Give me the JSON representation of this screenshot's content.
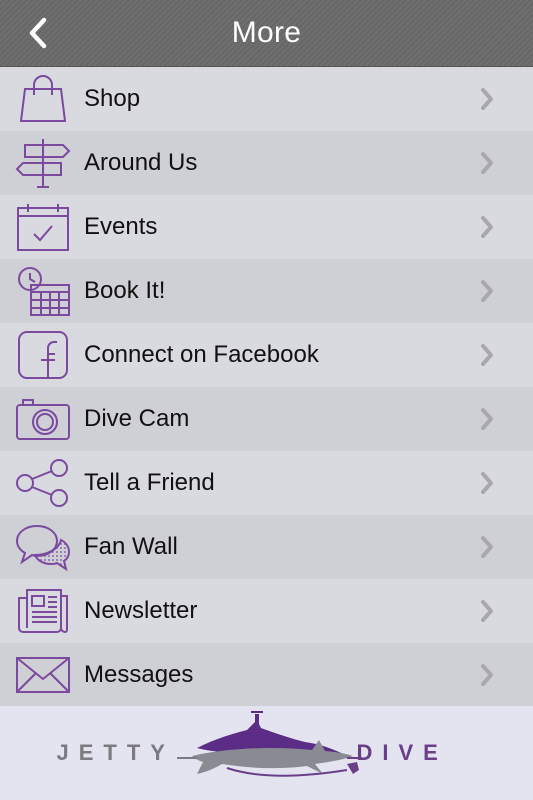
{
  "header": {
    "title": "More",
    "back_icon": "chevron-left-icon"
  },
  "colors": {
    "accent": "#7b4a9e",
    "header_bg": "#6c6c6c",
    "row_bg": "#d9d9e0",
    "row_alt_bg": "#cfcfd6",
    "chevron": "#a9a9ad"
  },
  "menu": {
    "items": [
      {
        "label": "Shop",
        "icon": "shopping-bag-icon"
      },
      {
        "label": "Around Us",
        "icon": "signpost-icon"
      },
      {
        "label": "Events",
        "icon": "calendar-check-icon"
      },
      {
        "label": "Book It!",
        "icon": "calendar-clock-icon"
      },
      {
        "label": "Connect on Facebook",
        "icon": "facebook-icon"
      },
      {
        "label": "Dive Cam",
        "icon": "camera-icon"
      },
      {
        "label": "Tell a Friend",
        "icon": "share-icon"
      },
      {
        "label": "Fan Wall",
        "icon": "chat-bubbles-icon"
      },
      {
        "label": "Newsletter",
        "icon": "newspaper-icon"
      },
      {
        "label": "Messages",
        "icon": "envelope-icon"
      }
    ]
  },
  "footer": {
    "logo_left": "JETTY",
    "logo_right": "DIVE"
  }
}
